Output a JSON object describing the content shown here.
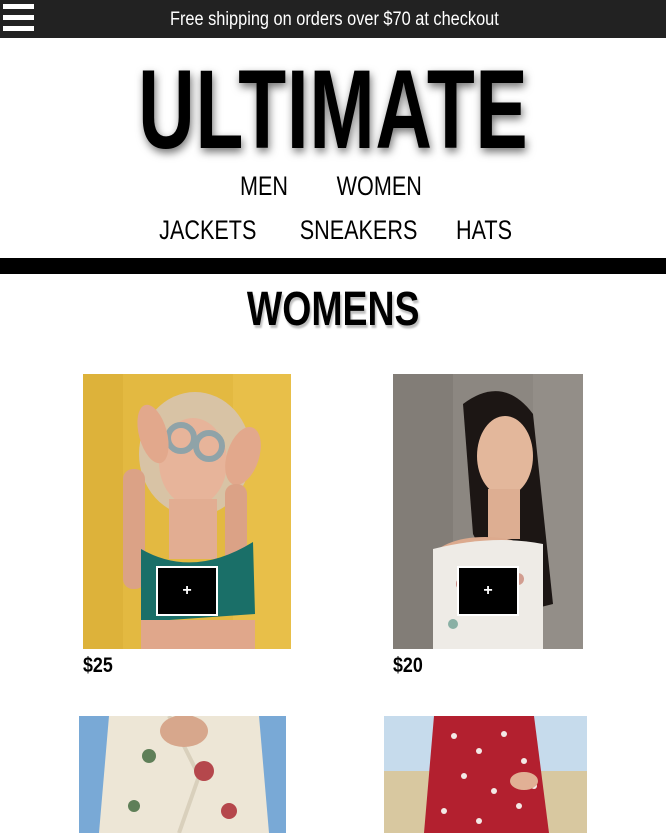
{
  "top_bar": {
    "menu_icon": "hamburger-menu-icon",
    "promo_text": "Free shipping on orders over $70 at checkout",
    "background_color": "#222222"
  },
  "brand": {
    "logo_text": "ULTIMATE"
  },
  "nav": {
    "primary": [
      "MEN",
      "WOMEN"
    ],
    "categories": [
      "JACKETS",
      "SNEAKERS",
      "HATS"
    ]
  },
  "section": {
    "title": "WOMENS"
  },
  "products": [
    {
      "price": "$25",
      "add_label": "+"
    },
    {
      "price": "$20",
      "add_label": "+"
    },
    {
      "price": "",
      "add_label": ""
    },
    {
      "price": "",
      "add_label": ""
    }
  ]
}
